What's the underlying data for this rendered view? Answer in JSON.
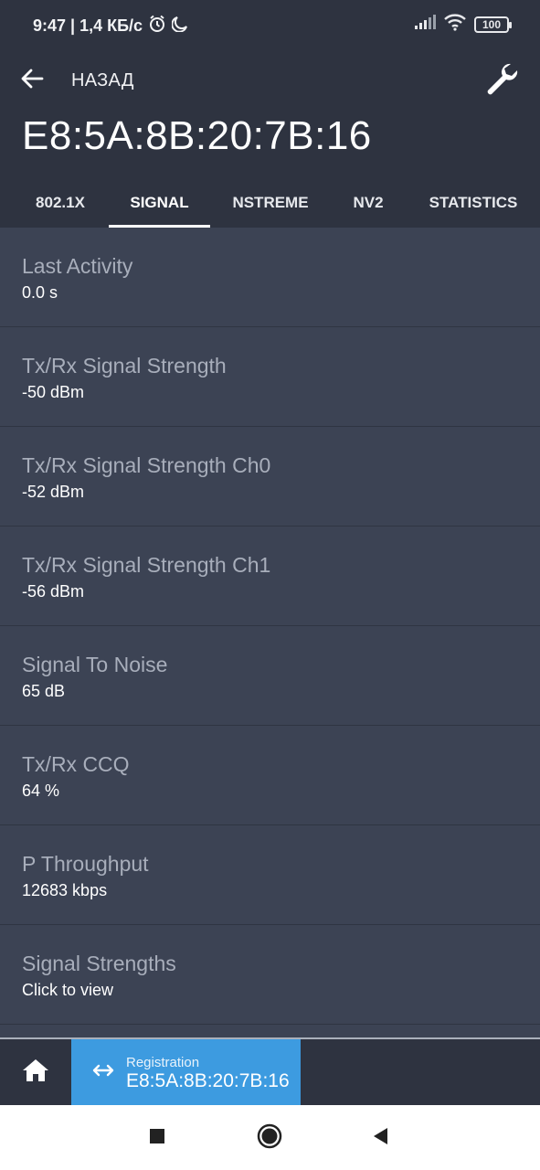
{
  "statusbar": {
    "time_info": "9:47 | 1,4 КБ/с",
    "battery": "100",
    "icons": [
      "alarm-icon",
      "moon-icon",
      "signal-icon",
      "wifi-icon",
      "battery-icon"
    ]
  },
  "header": {
    "back_label": "НАЗАД",
    "title": "E8:5A:8B:20:7B:16",
    "wrench_icon": "wrench-icon"
  },
  "tabs": [
    {
      "label": "802.1X",
      "active": false
    },
    {
      "label": "SIGNAL",
      "active": true
    },
    {
      "label": "NSTREME",
      "active": false
    },
    {
      "label": "NV2",
      "active": false
    },
    {
      "label": "STATISTICS",
      "active": false
    }
  ],
  "items": [
    {
      "label": "Last Activity",
      "value": "0.0 s"
    },
    {
      "label": "Tx/Rx Signal Strength",
      "value": "-50 dBm"
    },
    {
      "label": "Tx/Rx Signal Strength Ch0",
      "value": "-52 dBm"
    },
    {
      "label": "Tx/Rx Signal Strength Ch1",
      "value": "-56 dBm"
    },
    {
      "label": "Signal To Noise",
      "value": "65 dB"
    },
    {
      "label": "Tx/Rx CCQ",
      "value": "64 %"
    },
    {
      "label": "P Throughput",
      "value": "12683 kbps"
    },
    {
      "label": "Signal Strengths",
      "value": "Click to view"
    }
  ],
  "bottombar": {
    "reg_small": "Registration",
    "reg_big": "E8:5A:8B:20:7B:16"
  },
  "colors": {
    "header_bg": "#2e3340",
    "content_bg": "#3c4354",
    "accent": "#3d9be0"
  }
}
